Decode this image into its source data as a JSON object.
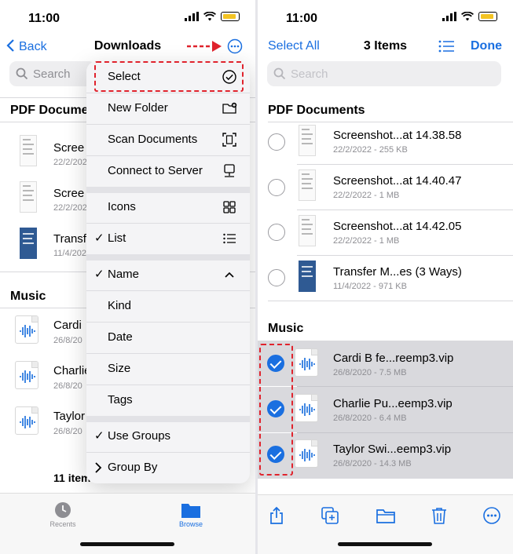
{
  "status": {
    "time": "11:00"
  },
  "left": {
    "nav": {
      "back_label": "Back",
      "title": "Downloads"
    },
    "search_placeholder": "Search",
    "sections": {
      "pdf": "PDF Documen",
      "music": "Music"
    },
    "pdf_items": [
      {
        "name": "Scree",
        "meta": "22/2/202"
      },
      {
        "name": "Scree",
        "meta": "22/2/202"
      },
      {
        "name": "Transf",
        "meta": "11/4/202"
      }
    ],
    "music_items": [
      {
        "name": "Cardi",
        "meta": "26/8/20"
      },
      {
        "name": "Charlie",
        "meta": "26/8/20"
      },
      {
        "name": "Taylor",
        "meta": "26/8/20"
      }
    ],
    "items_count": "11 item",
    "menu": {
      "select": "Select",
      "new_folder": "New Folder",
      "scan_documents": "Scan Documents",
      "connect_to_server": "Connect to Server",
      "icons": "Icons",
      "list": "List",
      "name": "Name",
      "kind": "Kind",
      "date": "Date",
      "size": "Size",
      "tags": "Tags",
      "use_groups": "Use Groups",
      "group_by": "Group By"
    },
    "tabs": {
      "recents": "Recents",
      "browse": "Browse"
    }
  },
  "right": {
    "nav": {
      "select_all": "Select All",
      "title": "3 Items",
      "done": "Done"
    },
    "search_placeholder": "Search",
    "sections": {
      "pdf": "PDF Documents",
      "music": "Music"
    },
    "pdf_items": [
      {
        "name": "Screenshot...at 14.38.58",
        "meta": "22/2/2022 - 255 KB"
      },
      {
        "name": "Screenshot...at 14.40.47",
        "meta": "22/2/2022 - 1 MB"
      },
      {
        "name": "Screenshot...at 14.42.05",
        "meta": "22/2/2022 - 1 MB"
      },
      {
        "name": "Transfer M...es (3 Ways)",
        "meta": "11/4/2022 - 971 KB"
      }
    ],
    "music_items": [
      {
        "name": "Cardi B fe...reemp3.vip",
        "meta": "26/8/2020 - 7.5 MB"
      },
      {
        "name": "Charlie Pu...eemp3.vip",
        "meta": "26/8/2020 - 6.4 MB"
      },
      {
        "name": "Taylor Swi...eemp3.vip",
        "meta": "26/8/2020 - 14.3 MB"
      }
    ]
  },
  "colors": {
    "accent": "#1a6fe0",
    "highlight": "#e0232d",
    "battery": "#f3c322"
  }
}
